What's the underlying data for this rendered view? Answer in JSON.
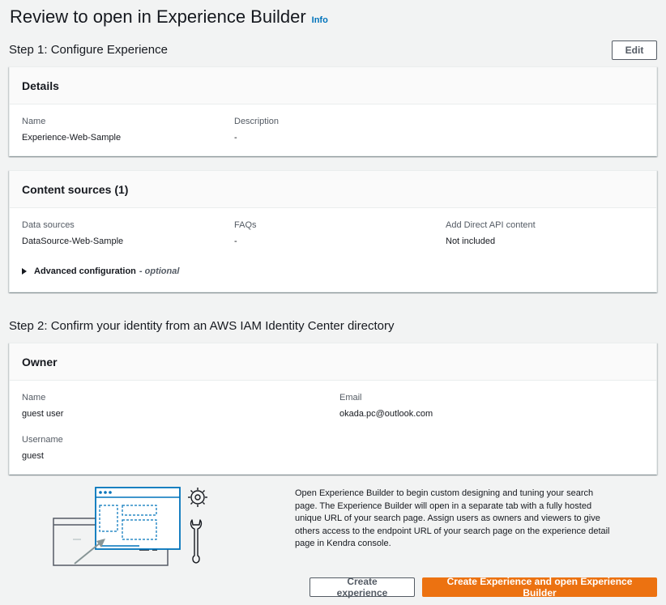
{
  "page": {
    "title": "Review to open in Experience Builder",
    "info_label": "Info"
  },
  "step1": {
    "title": "Step 1: Configure Experience",
    "edit_label": "Edit",
    "details": {
      "heading": "Details",
      "name_label": "Name",
      "name_value": "Experience-Web-Sample",
      "description_label": "Description",
      "description_value": "-"
    },
    "content_sources": {
      "heading": "Content sources (1)",
      "data_sources_label": "Data sources",
      "data_sources_value": "DataSource-Web-Sample",
      "faqs_label": "FAQs",
      "faqs_value": "-",
      "direct_api_label": "Add Direct API content",
      "direct_api_value": "Not included",
      "advanced_label": "Advanced configuration",
      "advanced_optional": "- optional"
    }
  },
  "step2": {
    "title": "Step 2: Confirm your identity from an AWS IAM Identity Center directory",
    "owner": {
      "heading": "Owner",
      "name_label": "Name",
      "name_value": "guest user",
      "email_label": "Email",
      "email_value": "okada.pc@outlook.com",
      "username_label": "Username",
      "username_value": "guest"
    }
  },
  "footer": {
    "description": "Open Experience Builder to begin custom designing and tuning your search page. The Experience Builder will open in a separate tab with a fully hosted unique URL of your search page. Assign users as owners and viewers to give others access to the endpoint URL of your search page on the experience detail page in Kendra console.",
    "create_label": "Create experience",
    "create_open_label": "Create Experience and open Experience Builder"
  },
  "colors": {
    "primary": "#ec7211",
    "link": "#0073bb",
    "accent_blue": "#0073bb",
    "text": "#16191f",
    "muted": "#545b64"
  },
  "icons": [
    "caret-right-icon",
    "gear-icon",
    "wrench-icon",
    "experience-builder-illustration"
  ]
}
